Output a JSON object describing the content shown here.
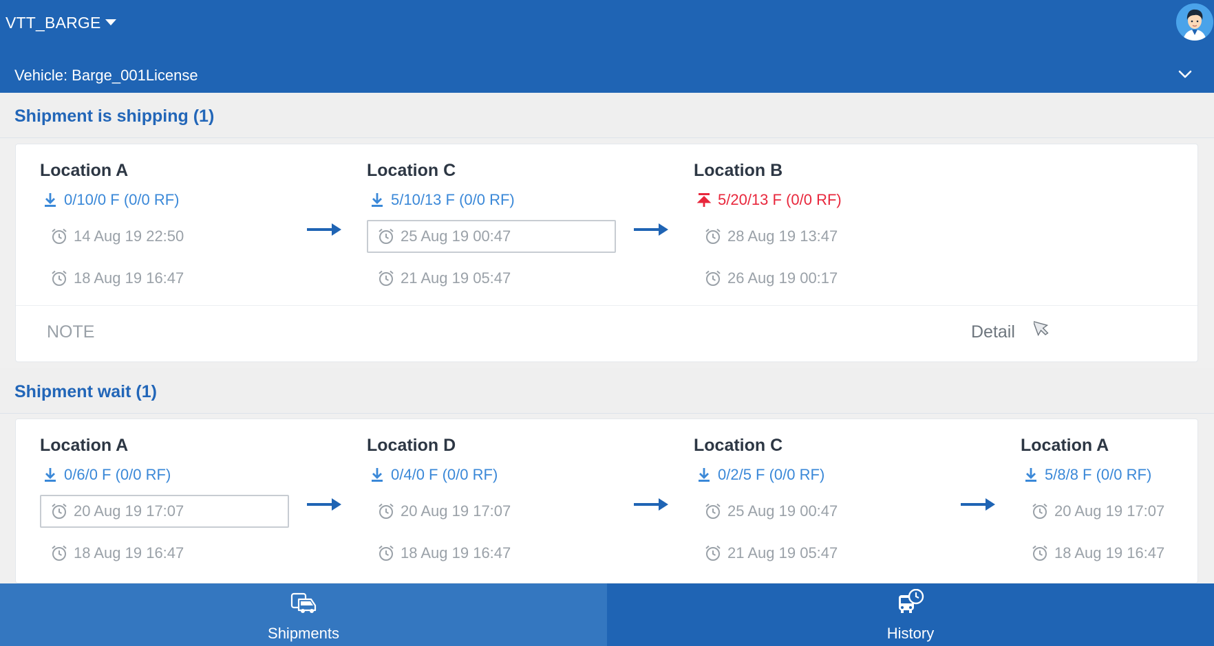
{
  "app": {
    "title": "VTT_BARGE"
  },
  "vehicle": {
    "label": "Vehicle: Barge_001License"
  },
  "sections": [
    {
      "title": "Shipment is shipping (1)",
      "stops": [
        {
          "name": "Location A",
          "qty": "0/10/0 F (0/0 RF)",
          "qty_type": "download",
          "time1": "14 Aug 19 22:50",
          "time2": "18 Aug 19 16:47"
        },
        {
          "name": "Location C",
          "qty": "5/10/13 F (0/0 RF)",
          "qty_type": "download",
          "time1": "25 Aug 19 00:47",
          "time2": "21 Aug 19 05:47"
        },
        {
          "name": "Location B",
          "qty": "5/20/13 F (0/0 RF)",
          "qty_type": "upload",
          "time1": "28 Aug 19 13:47",
          "time2": "26 Aug 19 00:17"
        }
      ],
      "footer": {
        "note": "NOTE",
        "detail": "Detail"
      }
    },
    {
      "title": "Shipment wait (1)",
      "stops": [
        {
          "name": "Location A",
          "qty": "0/6/0 F (0/0 RF)",
          "qty_type": "download",
          "time1": "20 Aug 19 17:07",
          "time2": "18 Aug 19 16:47"
        },
        {
          "name": "Location D",
          "qty": "0/4/0 F (0/0 RF)",
          "qty_type": "download",
          "time1": "20 Aug 19 17:07",
          "time2": "18 Aug 19 16:47"
        },
        {
          "name": "Location C",
          "qty": "0/2/5 F (0/0 RF)",
          "qty_type": "download",
          "time1": "25 Aug 19 00:47",
          "time2": "21 Aug 19 05:47"
        },
        {
          "name": "Location A",
          "qty": "5/8/8 F (0/0 RF)",
          "qty_type": "download",
          "time1": "20 Aug 19 17:07",
          "time2": "18 Aug 19 16:47"
        }
      ]
    }
  ],
  "tabs": [
    {
      "label": "Shipments",
      "icon": "shipments-icon",
      "active": true
    },
    {
      "label": "History",
      "icon": "history-icon",
      "active": false
    }
  ],
  "colors": {
    "primary": "#1f64b4",
    "accent_blue": "#3a88d8",
    "alert_red": "#e8273c",
    "muted_text": "#9aa1a8"
  }
}
